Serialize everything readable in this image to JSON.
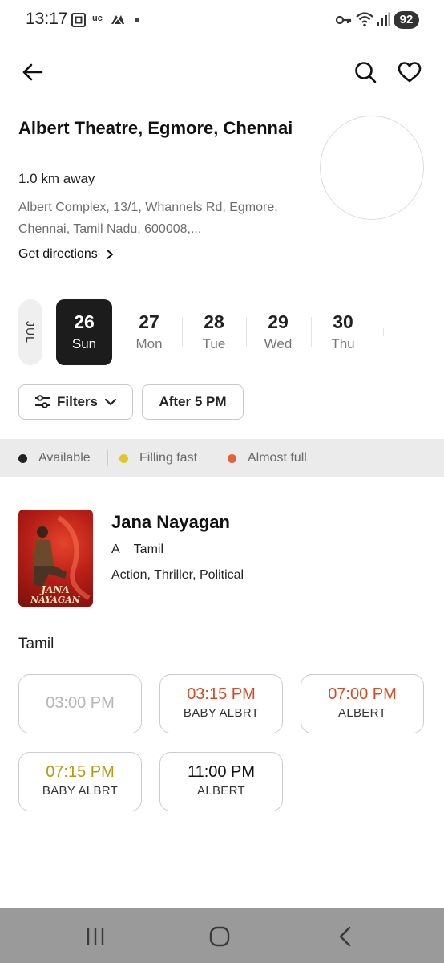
{
  "status_bar": {
    "time": "13:17",
    "carrier_badge": "uc",
    "battery": "92"
  },
  "header": {
    "icons": [
      "back-arrow-icon",
      "search-icon",
      "heart-icon"
    ]
  },
  "theatre": {
    "name": "Albert Theatre, Egmore, Chennai",
    "distance": "1.0 km away",
    "address": "Albert Complex, 13/1, Whannels Rd, Egmore, Chennai, Tamil Nadu, 600008,...",
    "directions_label": "Get directions"
  },
  "dates": {
    "month": "JUL",
    "items": [
      {
        "num": "26",
        "day": "Sun",
        "selected": true
      },
      {
        "num": "27",
        "day": "Mon",
        "selected": false
      },
      {
        "num": "28",
        "day": "Tue",
        "selected": false
      },
      {
        "num": "29",
        "day": "Wed",
        "selected": false
      },
      {
        "num": "30",
        "day": "Thu",
        "selected": false
      }
    ]
  },
  "filters": {
    "filters_label": "Filters",
    "after_label": "After 5 PM"
  },
  "legend": {
    "available": "Available",
    "filling_fast": "Filling fast",
    "almost_full": "Almost full",
    "colors": {
      "available": "#222222",
      "filling_fast": "#e2c52a",
      "almost_full": "#e0633e"
    }
  },
  "movie": {
    "title": "Jana Nayagan",
    "rating": "A",
    "language": "Tamil",
    "genres": "Action, Thriller, Political",
    "poster_text_line1": "JANA",
    "poster_text_line2": "NAYAGAN"
  },
  "showtimes": {
    "language_label": "Tamil",
    "items": [
      {
        "time": "03:00 PM",
        "screen": "",
        "status": "unavailable"
      },
      {
        "time": "03:15 PM",
        "screen": "BABY ALBRT",
        "status": "almost_full"
      },
      {
        "time": "07:00 PM",
        "screen": "ALBERT",
        "status": "almost_full"
      },
      {
        "time": "07:15 PM",
        "screen": "BABY ALBRT",
        "status": "filling_fast"
      },
      {
        "time": "11:00 PM",
        "screen": "ALBERT",
        "status": "available"
      }
    ]
  },
  "nav": {
    "icons": [
      "recent-apps-icon",
      "home-icon",
      "back-icon"
    ]
  }
}
